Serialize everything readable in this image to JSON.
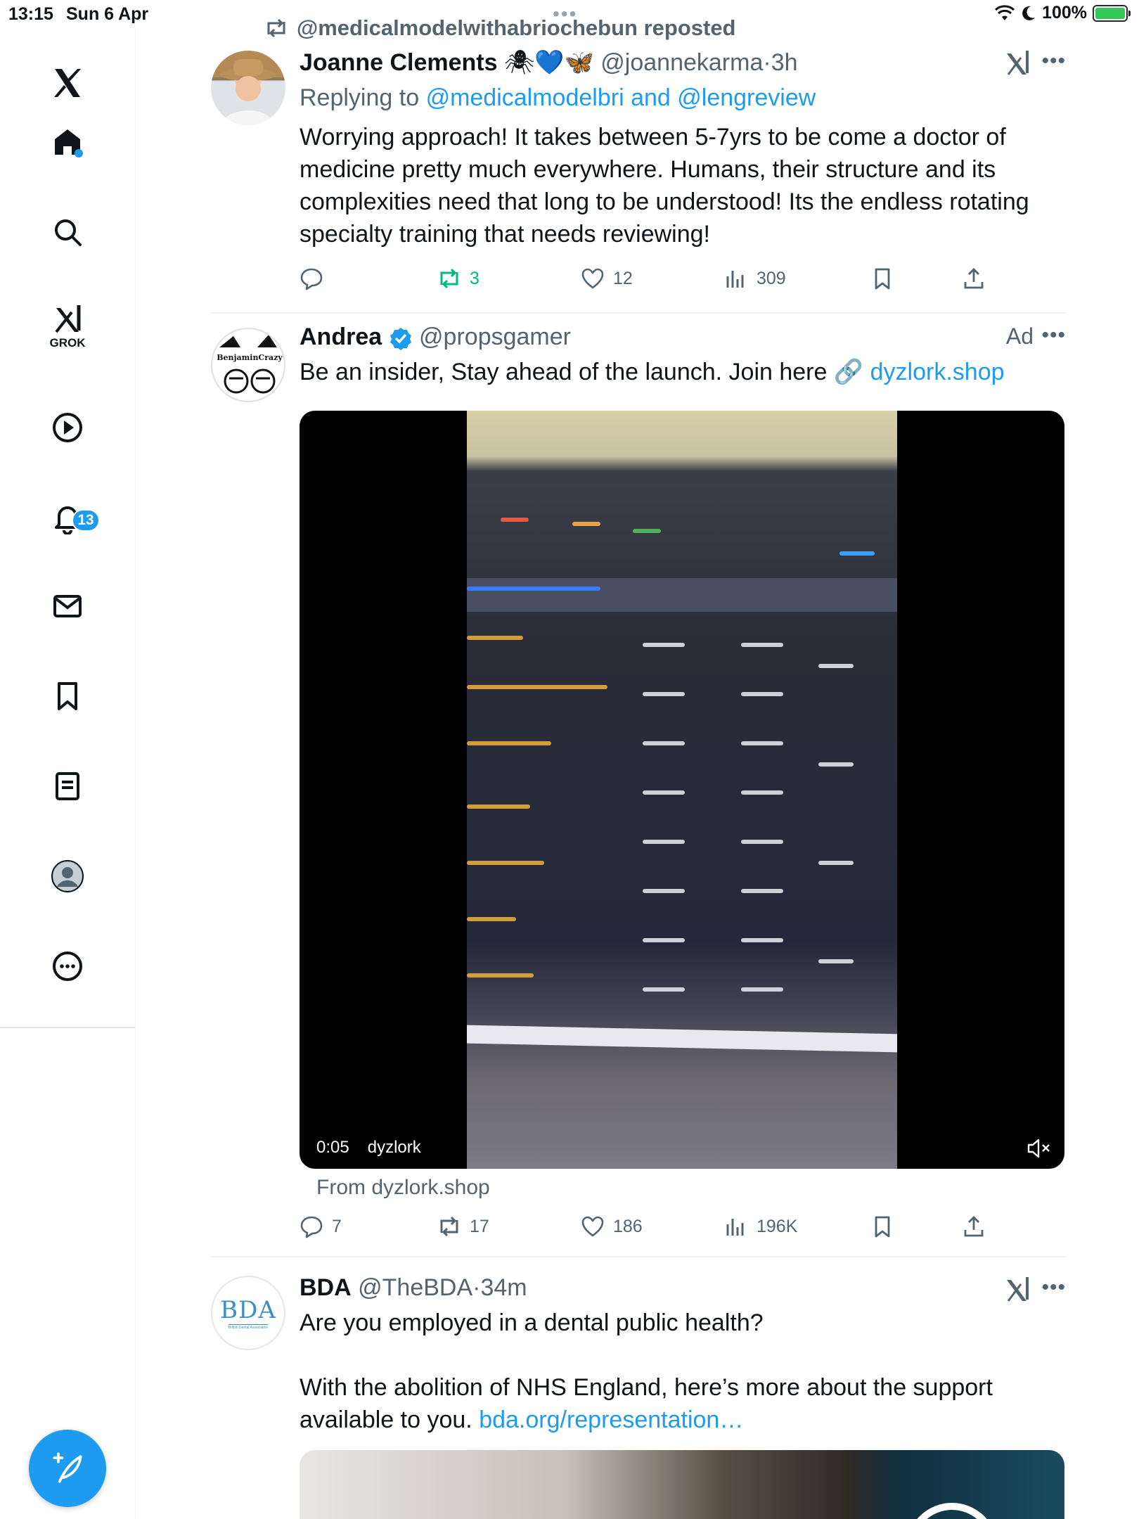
{
  "status": {
    "time": "13:15",
    "date": "Sun 6 Apr",
    "battery": "100%"
  },
  "sidebar": {
    "grok_label": "GROK",
    "notifications_badge": "13"
  },
  "posts": [
    {
      "repost_line": "@medicalmodelwithabriochebun reposted",
      "name": "Joanne Clements",
      "emoji": "🕷💙🦋",
      "handle": "@joannekarma",
      "time": "3h",
      "replying_prefix": "Replying to",
      "replying_to_1": "@medicalmodelbri",
      "replying_and": "and",
      "replying_to_2": "@lengreview",
      "text_lines": [
        "Worrying approach! It takes between 5-7yrs to be come a doctor of",
        "medicine pretty much everywhere. Humans, their structure and its",
        "complexities need that long to be understood! Its the endless rotating",
        "specialty training that needs reviewing!"
      ],
      "replies": "",
      "reposts": "3",
      "likes": "12",
      "views": "309"
    },
    {
      "name": "Andrea",
      "handle": "@propsgamer",
      "ad_label": "Ad",
      "avatar_text": "BenjaminCrazy",
      "text": "Be an insider, Stay ahead of the launch. Join here 🔗",
      "link": "dyzlork.shop",
      "video_time": "0:05",
      "video_source": "dyzlork",
      "from_line": "From dyzlork.shop",
      "replies": "7",
      "reposts": "17",
      "likes": "186",
      "views": "196K"
    },
    {
      "name": "BDA",
      "handle": "@TheBDA",
      "time": "34m",
      "avatar_text": "BDA",
      "avatar_subtext": "British Dental Association",
      "line1": "Are you employed in a dental public health?",
      "line2": "With the abolition of NHS England, here’s more about the support",
      "line3_prefix": "available to you.",
      "line3_link": "bda.org/representation…"
    }
  ],
  "colors": {
    "accent": "#1d9bf0",
    "repost_green": "#00ba7c",
    "muted": "#536471"
  }
}
